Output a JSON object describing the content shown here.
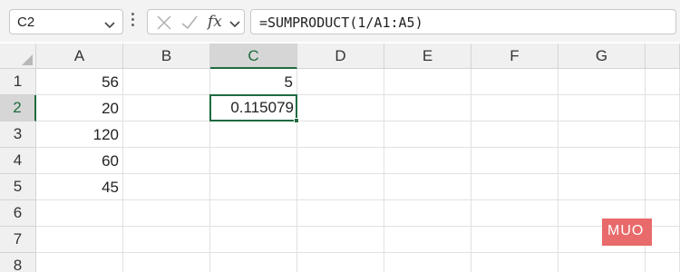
{
  "name_box": {
    "value": "C2"
  },
  "formula_bar": {
    "fx_label": "fx",
    "formula": "=SUMPRODUCT(1/A1:A5)"
  },
  "columns": [
    "A",
    "B",
    "C",
    "D",
    "E",
    "F",
    "G"
  ],
  "rows": [
    "1",
    "2",
    "3",
    "4",
    "5",
    "6",
    "7",
    "8"
  ],
  "selected": {
    "column": "C",
    "row": "2"
  },
  "cells": {
    "A1": "56",
    "A2": "20",
    "A3": "120",
    "A4": "60",
    "A5": "45",
    "C1": "5",
    "C2": "0.115079"
  },
  "watermark": {
    "text": "MUO"
  },
  "colors": {
    "accent": "#1e6b3f",
    "logo": "#e86a6a"
  }
}
